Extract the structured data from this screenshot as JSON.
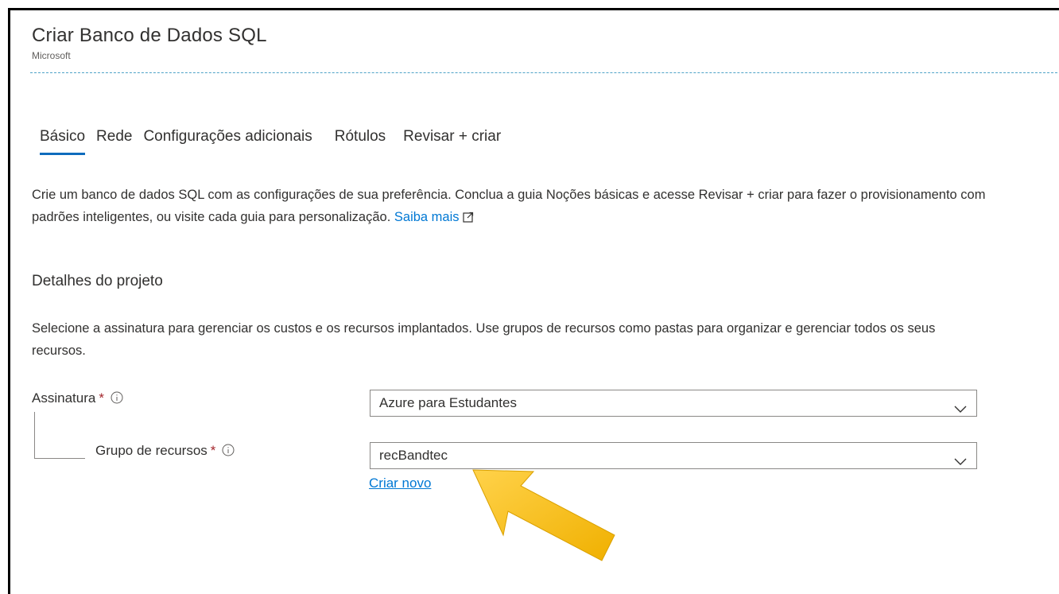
{
  "header": {
    "title": "Criar Banco de Dados SQL",
    "publisher": "Microsoft"
  },
  "tabs": [
    {
      "label": "Básico",
      "active": true
    },
    {
      "label": "Rede",
      "active": false
    },
    {
      "label": "Configurações adicionais",
      "active": false
    },
    {
      "label": "Rótulos",
      "active": false
    },
    {
      "label": "Revisar + criar",
      "active": false
    }
  ],
  "intro": {
    "text": "Crie um banco de dados SQL com as configurações de sua preferência. Conclua a guia Noções básicas e acesse Revisar + criar para fazer o provisionamento com padrões inteligentes, ou visite cada guia para personalização.",
    "link_label": "Saiba mais"
  },
  "project_details": {
    "title": "Detalhes do projeto",
    "description": "Selecione a assinatura para gerenciar os custos e os recursos implantados. Use grupos de recursos como pastas para organizar e gerenciar todos os seus recursos.",
    "subscription": {
      "label": "Assinatura",
      "required_mark": "*",
      "value": "Azure para Estudantes"
    },
    "resource_group": {
      "label": "Grupo de recursos",
      "required_mark": "*",
      "value": "recBandtec",
      "create_new_label": "Criar novo"
    }
  },
  "colors": {
    "accent": "#0f6cbd",
    "link": "#0078d4",
    "required": "#a4262c",
    "callout_arrow": "#f5b800"
  },
  "icons": [
    "info-icon",
    "external-link-icon",
    "chevron-down-icon",
    "callout-arrow"
  ]
}
